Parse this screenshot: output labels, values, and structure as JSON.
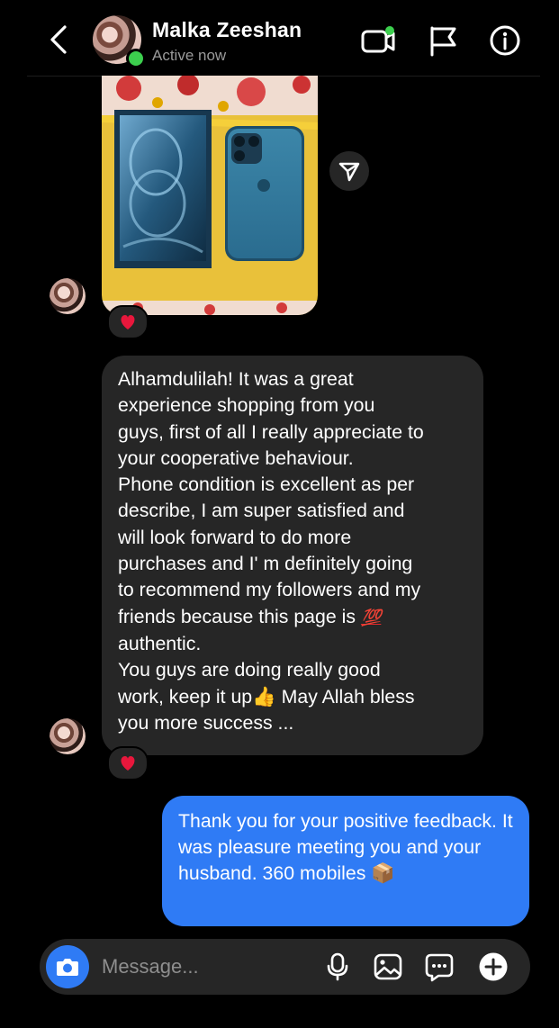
{
  "header": {
    "name": "Malka Zeeshan",
    "status": "Active now"
  },
  "icons": {
    "back": "chevron-left-icon",
    "video": "video-call-icon",
    "flag": "flag-icon",
    "info": "info-icon",
    "share": "send-arrow-icon",
    "camera": "camera-icon",
    "mic": "microphone-icon",
    "gallery": "image-icon",
    "sticker": "sticker-icon",
    "add": "plus-icon"
  },
  "messages": {
    "photo_reaction": "❤️",
    "received_text_lines": [
      "Alhamdulilah! It was a great",
      "experience shopping from you",
      "guys, first of all I really appreciate to",
      "your cooperative behaviour.",
      "Phone condition is excellent as per",
      "describe, I am super satisfied and",
      "will look forward to do more",
      "purchases and I' m definitely going",
      "to recommend my followers and my",
      "friends because this page is",
      "authentic.",
      "You guys are doing really good",
      "work, keep it up",
      "May Allah bless",
      "you more success ..."
    ],
    "received_emoji_100": "💯",
    "received_emoji_thumb": "👍",
    "received_reaction": "❤️",
    "sent_text": "Thank you for your positive feedback. It was pleasure meeting you and your husband. 360 mobiles",
    "sent_emoji": "📦"
  },
  "composer": {
    "placeholder": "Message..."
  },
  "colors": {
    "background": "#000000",
    "bubble_received": "#262626",
    "bubble_sent": "#2f7bf5",
    "online_dot": "#3ccf4e",
    "reaction_heart": "#e8173c"
  }
}
